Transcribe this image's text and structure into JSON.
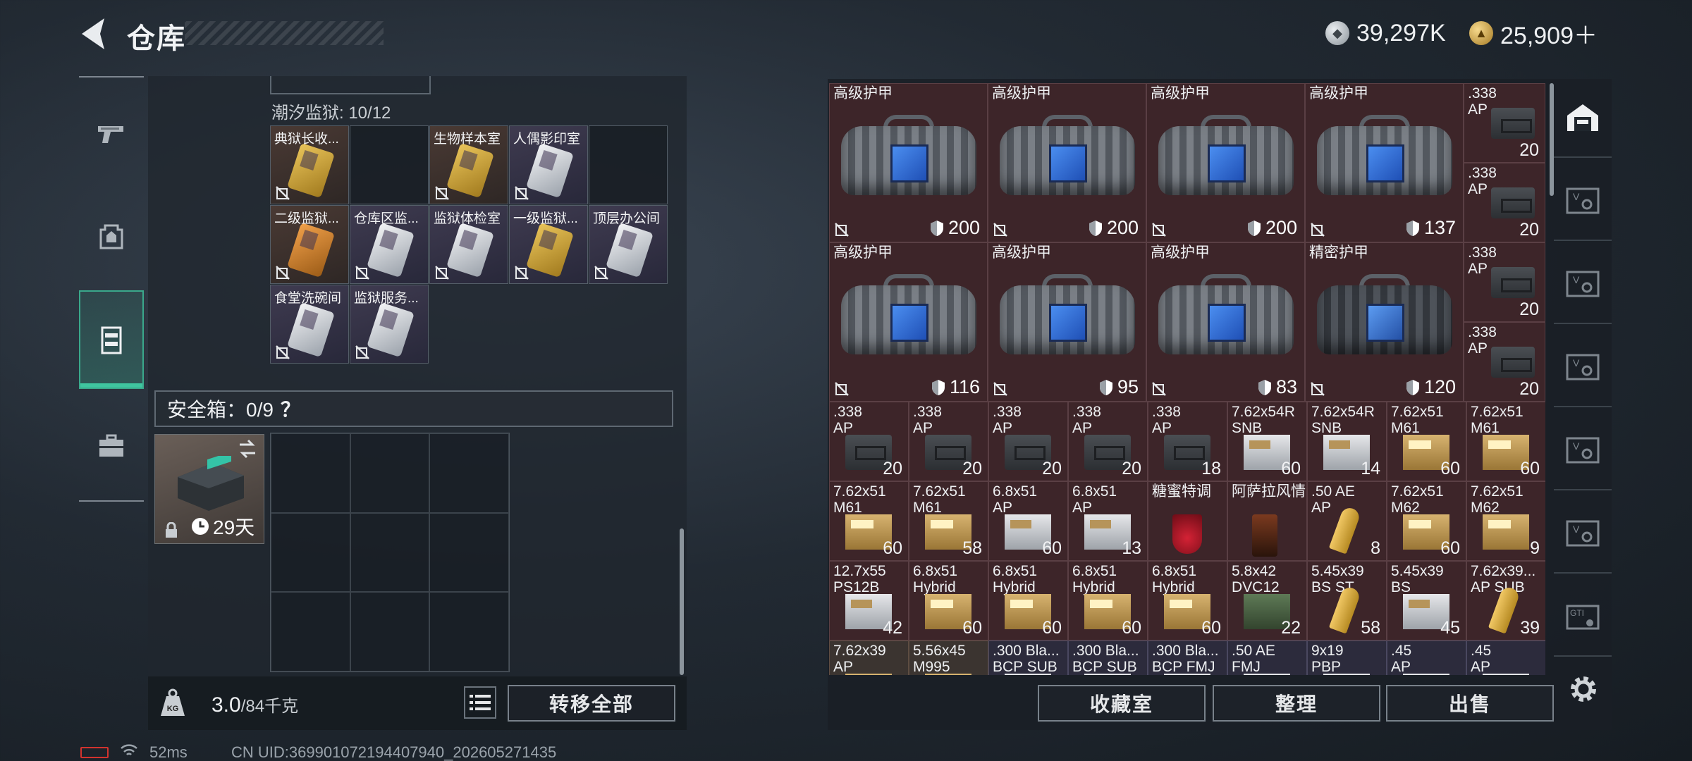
{
  "header": {
    "title": "仓库"
  },
  "currency": {
    "silver": "39,297K",
    "gold": "25,909＋"
  },
  "prison": {
    "label": "潮汐监狱: 10/12"
  },
  "keycards": [
    {
      "name": "典狱长收...",
      "bg": "gold-bg",
      "card": "gold",
      "row": 0,
      "col": 0
    },
    {
      "name": "",
      "bg": "empty",
      "card": "",
      "row": 0,
      "col": 1
    },
    {
      "name": "生物样本室",
      "bg": "gold-bg",
      "card": "gold",
      "row": 0,
      "col": 2
    },
    {
      "name": "人偶影印室",
      "bg": "purple-bg",
      "card": "silver",
      "row": 0,
      "col": 3
    },
    {
      "name": "",
      "bg": "empty",
      "card": "",
      "row": 0,
      "col": 4
    },
    {
      "name": "二级监狱...",
      "bg": "gold-bg",
      "card": "orange",
      "row": 1,
      "col": 0
    },
    {
      "name": "仓库区监...",
      "bg": "purple-bg",
      "card": "silver",
      "row": 1,
      "col": 1
    },
    {
      "name": "监狱体检室",
      "bg": "purple-bg",
      "card": "silver",
      "row": 1,
      "col": 2
    },
    {
      "name": "一级监狱...",
      "bg": "purple-bg",
      "card": "gold",
      "row": 1,
      "col": 3
    },
    {
      "name": "顶层办公间",
      "bg": "purple-bg",
      "card": "silver",
      "row": 1,
      "col": 4
    },
    {
      "name": "食堂洗碗间",
      "bg": "purple-bg",
      "card": "silver",
      "row": 2,
      "col": 0
    },
    {
      "name": "监狱服务...",
      "bg": "purple-bg",
      "card": "silver",
      "row": 2,
      "col": 1
    }
  ],
  "safe": {
    "label": "安全箱：0/9",
    "help": "？",
    "timer": "29天"
  },
  "weight": {
    "current": "3.0",
    "max": "/84千克"
  },
  "buttons": {
    "transfer_all": "转移全部",
    "collection": "收藏室",
    "sort": "整理",
    "sell": "出售"
  },
  "stash": {
    "armor": [
      {
        "name": "高级护甲",
        "durability": "200",
        "row": 0,
        "col": 0,
        "style": ""
      },
      {
        "name": "高级护甲",
        "durability": "200",
        "row": 0,
        "col": 1,
        "style": ""
      },
      {
        "name": "高级护甲",
        "durability": "200",
        "row": 0,
        "col": 2,
        "style": ""
      },
      {
        "name": "高级护甲",
        "durability": "137",
        "row": 0,
        "col": 3,
        "style": ""
      },
      {
        "name": "高级护甲",
        "durability": "116",
        "row": 1,
        "col": 0,
        "style": ""
      },
      {
        "name": "高级护甲",
        "durability": "95",
        "row": 1,
        "col": 1,
        "style": ""
      },
      {
        "name": "高级护甲",
        "durability": "83",
        "row": 1,
        "col": 2,
        "style": ""
      },
      {
        "name": "精密护甲",
        "durability": "120",
        "row": 1,
        "col": 3,
        "style": "dark"
      }
    ],
    "side_ammo": [
      {
        "name": ".338\nAP",
        "count": "20",
        "row": 0
      },
      {
        "name": ".338\nAP",
        "count": "20",
        "row": 1
      },
      {
        "name": ".338\nAP",
        "count": "20",
        "row": 2
      },
      {
        "name": ".338\nAP",
        "count": "20",
        "row": 3
      }
    ],
    "rows": [
      [
        {
          "name": ".338\nAP",
          "count": "20",
          "img": "box-dark",
          "bg": ""
        },
        {
          "name": ".338\nAP",
          "count": "20",
          "img": "box-dark",
          "bg": ""
        },
        {
          "name": ".338\nAP",
          "count": "20",
          "img": "box-dark",
          "bg": ""
        },
        {
          "name": ".338\nAP",
          "count": "20",
          "img": "box-dark",
          "bg": ""
        },
        {
          "name": ".338\nAP",
          "count": "18",
          "img": "box-dark",
          "bg": ""
        },
        {
          "name": "7.62x54R\nSNB",
          "count": "60",
          "img": "box-white",
          "bg": ""
        },
        {
          "name": "7.62x54R\nSNB",
          "count": "14",
          "img": "box-white",
          "bg": ""
        },
        {
          "name": "7.62x51\nM61",
          "count": "60",
          "img": "box-tan",
          "bg": ""
        },
        {
          "name": "7.62x51\nM61",
          "count": "60",
          "img": "box-tan",
          "bg": ""
        }
      ],
      [
        {
          "name": "7.62x51\nM61",
          "count": "60",
          "img": "box-tan",
          "bg": ""
        },
        {
          "name": "7.62x51\nM61",
          "count": "58",
          "img": "box-tan",
          "bg": ""
        },
        {
          "name": "6.8x51\nAP",
          "count": "60",
          "img": "box-white",
          "bg": ""
        },
        {
          "name": "6.8x51\nAP",
          "count": "13",
          "img": "box-white",
          "bg": ""
        },
        {
          "name": "糖蜜特调",
          "count": "",
          "img": "drink-red",
          "bg": ""
        },
        {
          "name": "阿萨拉风情",
          "count": "",
          "img": "drink-dark",
          "bg": ""
        },
        {
          "name": ".50 AE\nAP",
          "count": "8",
          "img": "bullet",
          "bg": ""
        },
        {
          "name": "7.62x51\nM62",
          "count": "60",
          "img": "box-tan",
          "bg": ""
        },
        {
          "name": "7.62x51\nM62",
          "count": "9",
          "img": "box-tan",
          "bg": ""
        }
      ],
      [
        {
          "name": "12.7x55\nPS12B",
          "count": "42",
          "img": "box-white",
          "bg": ""
        },
        {
          "name": "6.8x51\nHybrid",
          "count": "60",
          "img": "box-tan",
          "bg": ""
        },
        {
          "name": "6.8x51\nHybrid",
          "count": "60",
          "img": "box-tan",
          "bg": ""
        },
        {
          "name": "6.8x51\nHybrid",
          "count": "60",
          "img": "box-tan",
          "bg": ""
        },
        {
          "name": "6.8x51\nHybrid",
          "count": "60",
          "img": "box-tan",
          "bg": ""
        },
        {
          "name": "5.8x42\nDVC12",
          "count": "22",
          "img": "box-green",
          "bg": ""
        },
        {
          "name": "5.45x39\nBS ST",
          "count": "58",
          "img": "bullet",
          "bg": ""
        },
        {
          "name": "5.45x39\nBS",
          "count": "45",
          "img": "box-white",
          "bg": ""
        },
        {
          "name": "7.62x39...\nAP SUB",
          "count": "39",
          "img": "bullet",
          "bg": ""
        }
      ],
      [
        {
          "name": "7.62x39\nAP",
          "count": "",
          "img": "box-tan",
          "bg": "tan"
        },
        {
          "name": "5.56x45\nM995",
          "count": "",
          "img": "box-tan",
          "bg": "tan"
        },
        {
          "name": ".300 Bla...\nBCP SUB",
          "count": "",
          "img": "box-white",
          "bg": "purple"
        },
        {
          "name": ".300 Bla...\nBCP SUB",
          "count": "",
          "img": "box-white",
          "bg": "purple"
        },
        {
          "name": ".300 Bla...\nBCP FMJ",
          "count": "",
          "img": "box-white",
          "bg": "purple"
        },
        {
          "name": ".50 AE\nFMJ",
          "count": "",
          "img": "box-white",
          "bg": "purple"
        },
        {
          "name": "9x19\nPBP",
          "count": "",
          "img": "box-white",
          "bg": "purple"
        },
        {
          "name": ".45\nAP",
          "count": "",
          "img": "box-white",
          "bg": "purple"
        },
        {
          "name": ".45\nAP",
          "count": "",
          "img": "box-white",
          "bg": "purple"
        }
      ]
    ]
  },
  "status": {
    "ping": "52ms",
    "uid": "CN UID:369901072194407940_202605271435"
  },
  "icons": {
    "back": "back-arrow-icon",
    "weapons": "pistol-icon",
    "gear": "backpack-icon",
    "storage": "locker-icon",
    "kits": "toolbox-icon",
    "settings": "gear-icon"
  }
}
